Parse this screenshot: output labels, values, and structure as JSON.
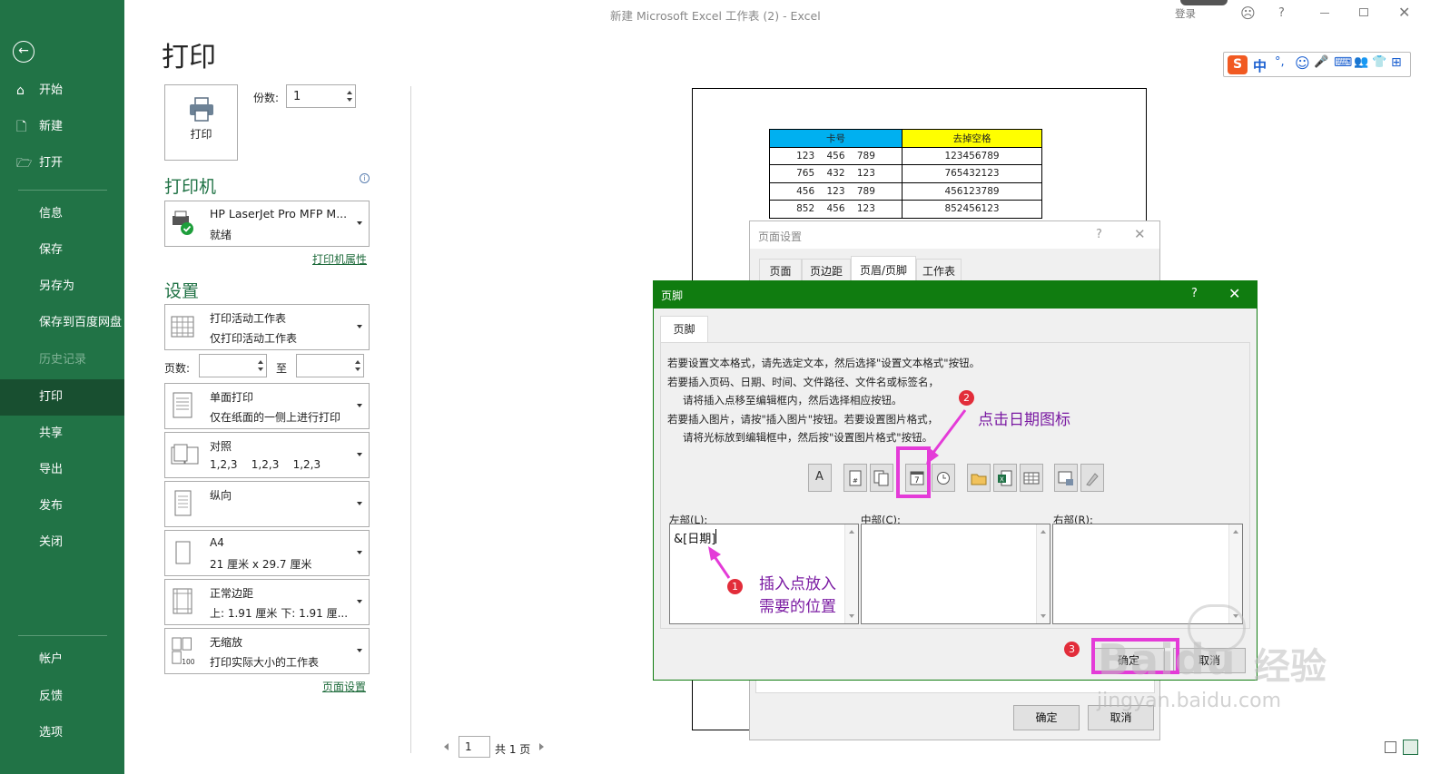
{
  "window": {
    "title": "新建 Microsoft Excel 工作表 (2)  -  Excel",
    "signin": "登录",
    "help": "?",
    "ime_items": [
      "S",
      "中",
      "°,",
      "☺",
      "🎤",
      "⌨",
      "👥",
      "👕",
      "⊞"
    ]
  },
  "sidebar": {
    "back_icon": "back-arrow-icon",
    "items": [
      {
        "label": "开始",
        "icon": "⌂",
        "disabled": false,
        "active": false
      },
      {
        "label": "新建",
        "icon": "🗋",
        "disabled": false,
        "active": false
      },
      {
        "label": "打开",
        "icon": "🗁",
        "disabled": false,
        "active": false
      },
      {
        "label": "信息",
        "disabled": false,
        "active": false
      },
      {
        "label": "保存",
        "disabled": false,
        "active": false
      },
      {
        "label": "另存为",
        "disabled": false,
        "active": false
      },
      {
        "label": "保存到百度网盘",
        "disabled": false,
        "active": false
      },
      {
        "label": "历史记录",
        "disabled": true,
        "active": false
      },
      {
        "label": "打印",
        "disabled": false,
        "active": true
      },
      {
        "label": "共享",
        "disabled": false,
        "active": false
      },
      {
        "label": "导出",
        "disabled": false,
        "active": false
      },
      {
        "label": "发布",
        "disabled": false,
        "active": false
      },
      {
        "label": "关闭",
        "disabled": false,
        "active": false
      },
      {
        "label": "帐户",
        "disabled": false,
        "active": false
      },
      {
        "label": "反馈",
        "disabled": false,
        "active": false
      },
      {
        "label": "选项",
        "disabled": false,
        "active": false
      }
    ]
  },
  "print": {
    "title": "打印",
    "print_button": "打印",
    "copies_label": "份数:",
    "copies_value": "1",
    "printer_section": "打印机",
    "printer_name": "HP LaserJet Pro MFP M...",
    "printer_status": "就绪",
    "printer_properties": "打印机属性",
    "settings_section": "设置",
    "settings": [
      {
        "line1": "打印活动工作表",
        "line2": "仅打印活动工作表"
      },
      {
        "line1": "单面打印",
        "line2": "仅在纸面的一侧上进行打印"
      },
      {
        "line1": "对照",
        "line2": "1,2,3    1,2,3    1,2,3"
      },
      {
        "line1": "纵向",
        "line2": ""
      },
      {
        "line1": "A4",
        "line2": "21 厘米 x 29.7 厘米"
      },
      {
        "line1": "正常边距",
        "line2": "上: 1.91 厘米 下: 1.91 厘..."
      },
      {
        "line1": "无缩放",
        "line2": "打印实际大小的工作表"
      }
    ],
    "pages_label": "页数:",
    "pages_to": "至",
    "page_setup_link": "页面设置"
  },
  "preview": {
    "table_header": [
      "卡号",
      "去掉空格"
    ],
    "rows": [
      [
        "123    456    789",
        "123456789"
      ],
      [
        "765    432    123",
        "765432123"
      ],
      [
        "456    123    789",
        "456123789"
      ],
      [
        "852    456    123",
        "852456123"
      ]
    ],
    "header_colors": [
      "#00b0f0",
      "#ffff00"
    ],
    "page_input": "1",
    "page_total": "共 1 页"
  },
  "page_setup_dialog": {
    "title": "页面设置",
    "help": "?",
    "tabs": [
      "页面",
      "页边距",
      "页眉/页脚",
      "工作表"
    ],
    "ok": "确定",
    "cancel": "取消"
  },
  "footer_dialog": {
    "title": "页脚",
    "help": "?",
    "tab": "页脚",
    "instructions": [
      "若要设置文本格式，请先选定文本，然后选择\"设置文本格式\"按钮。",
      "若要插入页码、日期、时间、文件路径、文件名或标签名，",
      "请将插入点移至编辑框内，然后选择相应按钮。",
      "若要插入图片，请按\"插入图片\"按钮。若要设置图片格式，",
      "请将光标放到编辑框中，然后按\"设置图片格式\"按钮。"
    ],
    "toolbar_icons": [
      "format-text-icon",
      "insert-page-number-icon",
      "insert-page-count-icon",
      "insert-date-icon",
      "insert-time-icon",
      "insert-file-path-icon",
      "insert-file-name-icon",
      "insert-sheet-name-icon",
      "insert-picture-icon",
      "format-picture-icon"
    ],
    "left_label": "左部(L):",
    "left_value": "&[日期]",
    "center_label": "中部(C):",
    "right_label": "右部(R):",
    "ok": "确定",
    "cancel": "取消",
    "accent_color": "#107c10"
  },
  "annotations": {
    "step1": "1",
    "step1_text_line1": "插入点放入",
    "step1_text_line2": "需要的位置",
    "step2": "2",
    "step2_text": "点击日期图标",
    "step3": "3",
    "color": "#e43bd8"
  },
  "watermark": {
    "brand": "Baidu",
    "brand_cn": "经验",
    "url": "jingyan.baidu.com"
  }
}
